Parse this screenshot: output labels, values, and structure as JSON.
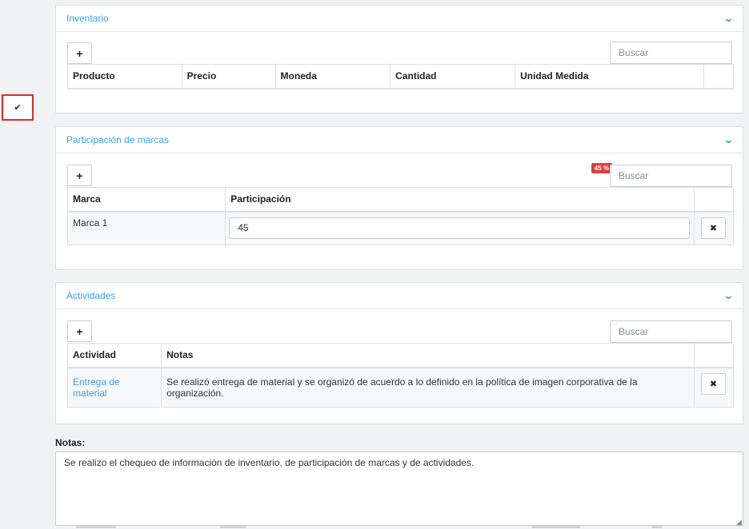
{
  "inventory": {
    "title": "Inventario",
    "add_label": "+",
    "search_placeholder": "Buscar",
    "columns": [
      "Producto",
      "Precio",
      "Moneda",
      "Cantidad",
      "Unidad Medida"
    ]
  },
  "brands": {
    "title": "Participación de marcas",
    "add_label": "+",
    "search_placeholder": "Buscar",
    "badge": "45 %",
    "columns": [
      "Marca",
      "Participación"
    ],
    "rows": [
      {
        "brand": "Marca 1",
        "share": "45"
      }
    ]
  },
  "activities": {
    "title": "Actividades",
    "add_label": "+",
    "search_placeholder": "Buscar",
    "columns": [
      "Actividad",
      "Notas"
    ],
    "rows": [
      {
        "activity": "Entrega de material",
        "notes": "Se realizó entrega de material y se organizó de acuerdo a lo definido en la política de imagen corporativa de la organización."
      }
    ]
  },
  "notes": {
    "label": "Notas:",
    "value": "Se realizo el chequeo de información de inventario, de participación de marcas y de actividades."
  },
  "icons": {
    "check": "check-icon",
    "chevron": "chevron-down-icon",
    "delete": "close-icon"
  },
  "colors": {
    "accent": "#3aa0dc",
    "badge": "#d9413e",
    "highlight_border": "#e0292b"
  }
}
